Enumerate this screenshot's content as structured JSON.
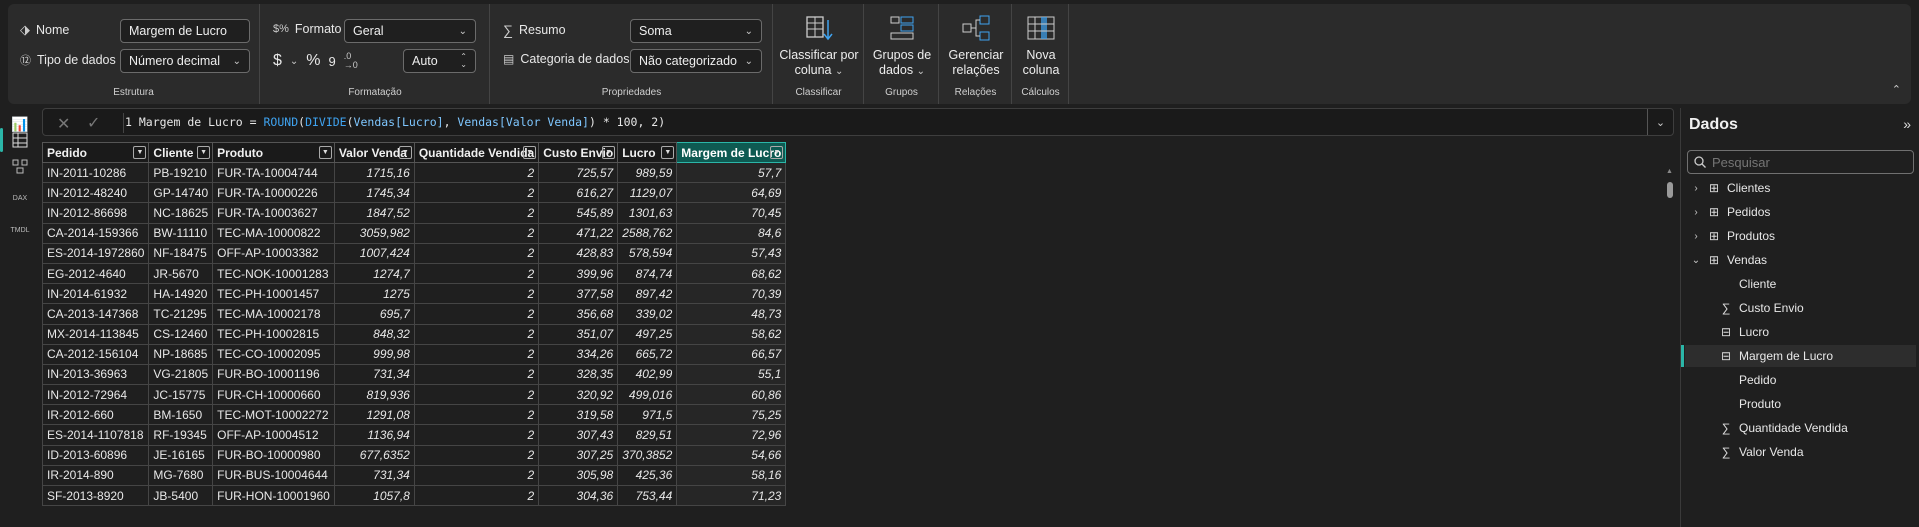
{
  "ribbon": {
    "estrutura": {
      "title": "Estrutura",
      "name_label": "Nome",
      "name_value": "Margem de Lucro",
      "datatype_label": "Tipo de dados",
      "datatype_value": "Número decimal"
    },
    "formatacao": {
      "title": "Formatação",
      "format_label": "Formato",
      "format_value": "Geral",
      "currency_symbol": "$",
      "percent_symbol": "%",
      "comma_symbol": "9",
      "decimals_value": "Auto"
    },
    "propriedades": {
      "title": "Propriedades",
      "summary_label": "Resumo",
      "summary_value": "Soma",
      "category_label": "Categoria de dados",
      "category_value": "Não categorizado"
    },
    "classificar": {
      "title": "Classificar",
      "button_line1": "Classificar por",
      "button_line2": "coluna"
    },
    "grupos": {
      "title": "Grupos",
      "button_line1": "Grupos de",
      "button_line2": "dados"
    },
    "relacoes": {
      "title": "Relações",
      "button_line1": "Gerenciar",
      "button_line2": "relações"
    },
    "calculos": {
      "title": "Cálculos",
      "button_line1": "Nova",
      "button_line2": "coluna"
    }
  },
  "formula_bar": {
    "line_number": "1",
    "prefix": " Margem de Lucro = ",
    "fn_round": "ROUND",
    "p1": "(",
    "fn_divide": "DIVIDE",
    "p2": "(",
    "col_lucro": "Vendas[Lucro]",
    "comma": ", ",
    "col_valor": "Vendas[Valor Venda]",
    "suffix": ") * 100, 2)"
  },
  "table": {
    "columns": [
      "Pedido",
      "Cliente",
      "Produto",
      "Valor Venda",
      "Quantidade Vendida",
      "Custo Envio",
      "Lucro",
      "Margem de Lucro"
    ],
    "rows": [
      [
        "IN-2011-10286",
        "PB-19210",
        "FUR-TA-10004744",
        "1715,16",
        "2",
        "725,57",
        "989,59",
        "57,7"
      ],
      [
        "IN-2012-48240",
        "GP-14740",
        "FUR-TA-10000226",
        "1745,34",
        "2",
        "616,27",
        "1129,07",
        "64,69"
      ],
      [
        "IN-2012-86698",
        "NC-18625",
        "FUR-TA-10003627",
        "1847,52",
        "2",
        "545,89",
        "1301,63",
        "70,45"
      ],
      [
        "CA-2014-159366",
        "BW-11110",
        "TEC-MA-10000822",
        "3059,982",
        "2",
        "471,22",
        "2588,762",
        "84,6"
      ],
      [
        "ES-2014-1972860",
        "NF-18475",
        "OFF-AP-10003382",
        "1007,424",
        "2",
        "428,83",
        "578,594",
        "57,43"
      ],
      [
        "EG-2012-4640",
        "JR-5670",
        "TEC-NOK-10001283",
        "1274,7",
        "2",
        "399,96",
        "874,74",
        "68,62"
      ],
      [
        "IN-2014-61932",
        "HA-14920",
        "TEC-PH-10001457",
        "1275",
        "2",
        "377,58",
        "897,42",
        "70,39"
      ],
      [
        "CA-2013-147368",
        "TC-21295",
        "TEC-MA-10002178",
        "695,7",
        "2",
        "356,68",
        "339,02",
        "48,73"
      ],
      [
        "MX-2014-113845",
        "CS-12460",
        "TEC-PH-10002815",
        "848,32",
        "2",
        "351,07",
        "497,25",
        "58,62"
      ],
      [
        "CA-2012-156104",
        "NP-18685",
        "TEC-CO-10002095",
        "999,98",
        "2",
        "334,26",
        "665,72",
        "66,57"
      ],
      [
        "IN-2013-36963",
        "VG-21805",
        "FUR-BO-10001196",
        "731,34",
        "2",
        "328,35",
        "402,99",
        "55,1"
      ],
      [
        "IN-2012-72964",
        "JC-15775",
        "FUR-CH-10000660",
        "819,936",
        "2",
        "320,92",
        "499,016",
        "60,86"
      ],
      [
        "IR-2012-660",
        "BM-1650",
        "TEC-MOT-10002272",
        "1291,08",
        "2",
        "319,58",
        "971,5",
        "75,25"
      ],
      [
        "ES-2014-1107818",
        "RF-19345",
        "OFF-AP-10004512",
        "1136,94",
        "2",
        "307,43",
        "829,51",
        "72,96"
      ],
      [
        "ID-2013-60896",
        "JE-16165",
        "FUR-BO-10000980",
        "677,6352",
        "2",
        "307,25",
        "370,3852",
        "54,66"
      ],
      [
        "IR-2014-890",
        "MG-7680",
        "FUR-BUS-10004644",
        "731,34",
        "2",
        "305,98",
        "425,36",
        "58,16"
      ],
      [
        "SF-2013-8920",
        "JB-5400",
        "FUR-HON-10001960",
        "1057,8",
        "2",
        "304,36",
        "753,44",
        "71,23"
      ]
    ]
  },
  "data_pane": {
    "title": "Dados",
    "search_placeholder": "Pesquisar",
    "tables": [
      "Clientes",
      "Pedidos",
      "Produtos",
      "Vendas"
    ],
    "fields": [
      {
        "label": "Cliente",
        "icon": "none"
      },
      {
        "label": "Custo Envio",
        "icon": "sigma-icon"
      },
      {
        "label": "Lucro",
        "icon": "calc-column-icon"
      },
      {
        "label": "Margem de Lucro",
        "icon": "calc-column-icon",
        "selected": true
      },
      {
        "label": "Pedido",
        "icon": "none"
      },
      {
        "label": "Produto",
        "icon": "none"
      },
      {
        "label": "Quantidade Vendida",
        "icon": "sigma-icon"
      },
      {
        "label": "Valor Venda",
        "icon": "sigma-icon"
      }
    ]
  },
  "colors": {
    "accent": "#2bb6a8",
    "selected_header": "#0e5a52",
    "function": "#3fa3f0"
  }
}
